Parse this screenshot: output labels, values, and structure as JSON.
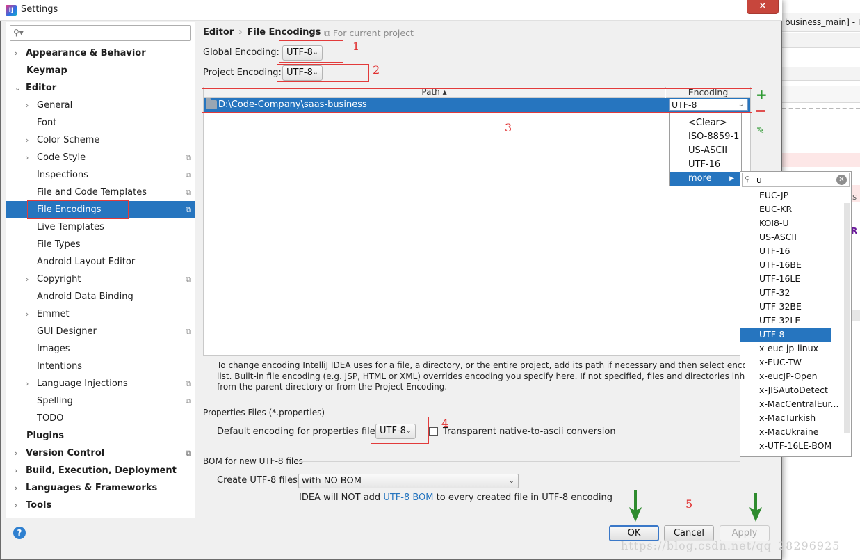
{
  "window": {
    "title": "Settings",
    "close_label": "✕"
  },
  "background_ide": {
    "title_fragment": "business_main] - In",
    "code_fragment_1": "s",
    "code_fragment_2": "R"
  },
  "sidebar": {
    "search": {
      "value": "",
      "placeholder": ""
    },
    "items": [
      {
        "label": "Appearance & Behavior",
        "bold": true,
        "expandable": true
      },
      {
        "label": "Keymap",
        "bold": true
      },
      {
        "label": "Editor",
        "bold": true,
        "expanded": true
      },
      {
        "label": "General",
        "expandable": true
      },
      {
        "label": "Font"
      },
      {
        "label": "Color Scheme",
        "expandable": true
      },
      {
        "label": "Code Style",
        "expandable": true,
        "project_scoped": true
      },
      {
        "label": "Inspections",
        "project_scoped": true
      },
      {
        "label": "File and Code Templates",
        "project_scoped": true
      },
      {
        "label": "File Encodings",
        "project_scoped": true,
        "selected": true
      },
      {
        "label": "Live Templates"
      },
      {
        "label": "File Types"
      },
      {
        "label": "Android Layout Editor"
      },
      {
        "label": "Copyright",
        "expandable": true,
        "project_scoped": true
      },
      {
        "label": "Android Data Binding"
      },
      {
        "label": "Emmet",
        "expandable": true
      },
      {
        "label": "GUI Designer",
        "project_scoped": true
      },
      {
        "label": "Images"
      },
      {
        "label": "Intentions"
      },
      {
        "label": "Language Injections",
        "expandable": true,
        "project_scoped": true
      },
      {
        "label": "Spelling",
        "project_scoped": true
      },
      {
        "label": "TODO"
      },
      {
        "label": "Plugins",
        "bold": true
      },
      {
        "label": "Version Control",
        "bold": true,
        "expandable": true,
        "project_scoped": true
      },
      {
        "label": "Build, Execution, Deployment",
        "bold": true,
        "expandable": true
      },
      {
        "label": "Languages & Frameworks",
        "bold": true,
        "expandable": true
      },
      {
        "label": "Tools",
        "bold": true,
        "expandable": true
      }
    ]
  },
  "header": {
    "breadcrumb_parent": "Editor",
    "breadcrumb_sep": "›",
    "breadcrumb_current": "File Encodings",
    "scope_note": "For current project"
  },
  "encodings": {
    "global_label": "Global Encoding:",
    "global_value": "UTF-8",
    "project_label": "Project Encoding:",
    "project_value": "UTF-8"
  },
  "table": {
    "col_path": "Path ▴",
    "col_encoding": "Encoding",
    "rows": [
      {
        "path": "D:\\Code-Company\\saas-business",
        "encoding": "UTF-8"
      }
    ]
  },
  "encoding_dropdown": {
    "options": [
      "<Clear>",
      "ISO-8859-1",
      "US-ASCII",
      "UTF-16",
      "more"
    ],
    "selected": "more"
  },
  "charset_popup": {
    "search_value": "u",
    "options": [
      "EUC-JP",
      "EUC-KR",
      "KOI8-U",
      "US-ASCII",
      "UTF-16",
      "UTF-16BE",
      "UTF-16LE",
      "UTF-32",
      "UTF-32BE",
      "UTF-32LE",
      "UTF-8",
      "x-euc-jp-linux",
      "x-EUC-TW",
      "x-eucJP-Open",
      "x-JISAutoDetect",
      "x-MacCentralEur...",
      "x-MacTurkish",
      "x-MacUkraine",
      "x-UTF-16LE-BOM"
    ],
    "selected": "UTF-8"
  },
  "description": {
    "line1": "To change encoding IntelliJ IDEA uses for a file, a directory, or the entire project, add its path if necessary and then select encoding from the enc",
    "line2": "list. Built-in file encoding (e.g. JSP, HTML or XML) overrides encoding you specify here. If not specified, files and directories inherit encoding set",
    "line3": "from the parent directory or from the Project Encoding."
  },
  "properties": {
    "section_title": "Properties Files (*.properties)",
    "default_label": "Default encoding for properties files:",
    "default_value": "UTF-8",
    "transparent_label": "Transparent native-to-ascii conversion",
    "transparent_checked": false
  },
  "bom": {
    "section_title": "BOM for new UTF-8 files",
    "create_label": "Create UTF-8 files:",
    "create_value": "with NO BOM",
    "note_prefix": "IDEA will NOT add ",
    "note_link": "UTF-8 BOM",
    "note_suffix": " to every created file in UTF-8 encoding"
  },
  "buttons": {
    "help": "?",
    "ok": "OK",
    "cancel": "Cancel",
    "apply": "Apply"
  },
  "annotations": [
    "1",
    "2",
    "3",
    "4",
    "5"
  ],
  "watermark": "https://blog.csdn.net/qq_28296925",
  "colors": {
    "selection": "#2675bf",
    "annotation_red": "#e23b3b",
    "arrow_green": "#2e8b2e"
  }
}
